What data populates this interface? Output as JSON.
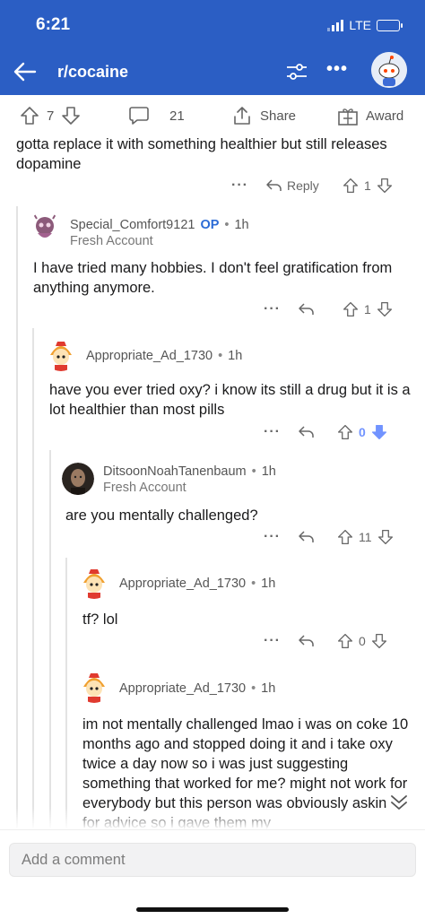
{
  "status": {
    "time": "6:21",
    "network": "LTE"
  },
  "header": {
    "title": "r/cocaine"
  },
  "post_actions": {
    "upvotes": "7",
    "comments": "21",
    "share_label": "Share",
    "award_label": "Award"
  },
  "comments": [
    {
      "text": "gotta replace it with something healthier but still releases dopamine",
      "reply_label": "Reply",
      "score": "1"
    },
    {
      "author": "Special_Comfort9121",
      "op": "OP",
      "age": "1h",
      "flair": "Fresh Account",
      "text": "I have tried many hobbies. I don't feel gratification from anything anymore.",
      "score": "1"
    },
    {
      "author": "Appropriate_Ad_1730",
      "age": "1h",
      "text": "have you ever tried oxy? i know its still a drug but it is a lot healthier than most pills",
      "score": "0"
    },
    {
      "author": "DitsoonNoahTanenbaum",
      "age": "1h",
      "flair": "Fresh Account",
      "text": "are you mentally challenged?",
      "score": "11"
    },
    {
      "author": "Appropriate_Ad_1730",
      "age": "1h",
      "text": "tf? lol",
      "score": "0"
    },
    {
      "author": "Appropriate_Ad_1730",
      "age": "1h",
      "text": "im not mentally challenged lmao i was on coke 10 months ago and stopped doing it and i take oxy twice a day now so i was just suggesting something that worked for me? might not work for everybody but this person was obviously asking for advice so i gave them my"
    }
  ],
  "composer": {
    "placeholder": "Add a comment"
  },
  "colors": {
    "header_bg": "#2b5ec4",
    "op": "#2b6bd6",
    "downvote_active": "#7193ff"
  }
}
